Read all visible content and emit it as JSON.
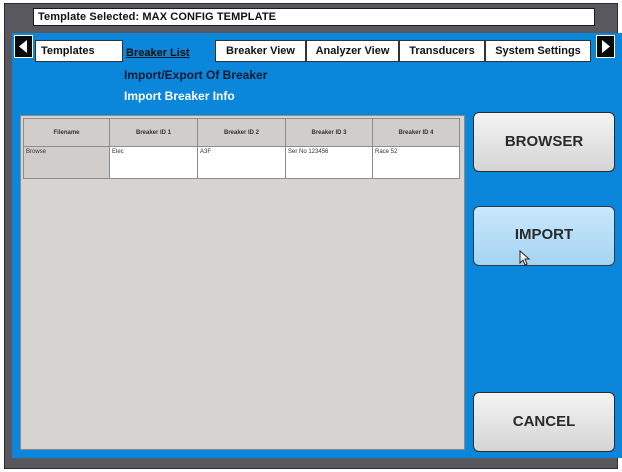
{
  "header": {
    "template_selected": "Template Selected: MAX CONFIG TEMPLATE"
  },
  "tabs": [
    {
      "label": "Templates"
    },
    {
      "label": "Breaker List"
    },
    {
      "label": "Breaker View"
    },
    {
      "label": "Analyzer View"
    },
    {
      "label": "Transducers"
    },
    {
      "label": "System Settings"
    }
  ],
  "active_tab": "Breaker List",
  "subnav": {
    "import_export": "Import/Export Of Breaker",
    "import_info": "Import Breaker Info"
  },
  "table": {
    "columns": [
      "Filename",
      "Breaker ID 1",
      "Breaker ID 2",
      "Breaker ID 3",
      "Breaker ID 4"
    ],
    "rows": [
      [
        "Browse",
        "Elec",
        "A3F",
        "Ser No 123456",
        "Race 52"
      ]
    ]
  },
  "buttons": {
    "browser": "BROWSER",
    "import": "IMPORT",
    "cancel": "CANCEL"
  },
  "colors": {
    "accent_blue": "#0a86da",
    "frame_gray": "#58585e",
    "import_button": "#b4dcf6"
  },
  "icons": {
    "nav_left": "triangle-left-icon",
    "nav_right": "triangle-right-icon",
    "cursor": "mouse-pointer-icon"
  }
}
